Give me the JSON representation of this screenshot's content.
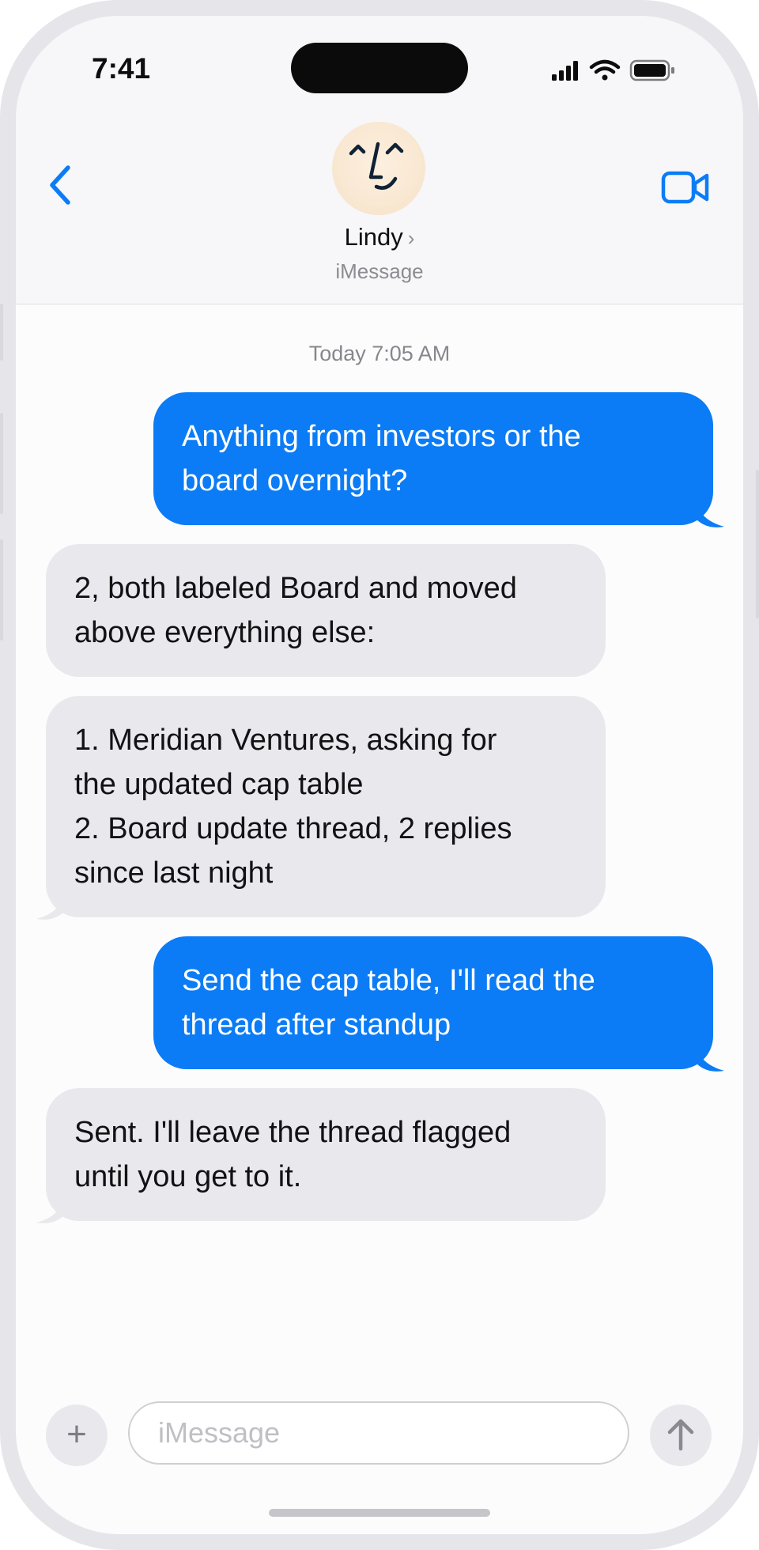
{
  "status_bar": {
    "time": "7:41"
  },
  "header": {
    "contact_name": "Lindy",
    "name_chevron": "›",
    "service": "iMessage"
  },
  "thread": {
    "timestamp": "Today 7:05 AM",
    "messages": [
      {
        "direction": "outgoing",
        "text": "Anything from investors or the\nboard overnight?"
      },
      {
        "direction": "incoming",
        "text": "2, both labeled Board and moved\nabove everything else:"
      },
      {
        "direction": "incoming",
        "text": "1. Meridian Ventures, asking for\nthe updated cap table\n2. Board update thread, 2 replies\nsince last night"
      },
      {
        "direction": "outgoing",
        "text": "Send the cap table, I'll read the\nthread after standup"
      },
      {
        "direction": "incoming",
        "text": "Sent. I'll leave the thread flagged\nuntil you get to it."
      }
    ]
  },
  "composer": {
    "plus_label": "+",
    "placeholder": "iMessage"
  },
  "colors": {
    "accent": "#0b7cf5",
    "incoming_bubble": "#e9e8ed",
    "background": "#fdfcfd"
  },
  "icons": [
    "back-chevron-icon",
    "video-camera-icon",
    "signal-icon",
    "wifi-icon",
    "battery-icon",
    "send-arrow-icon"
  ]
}
